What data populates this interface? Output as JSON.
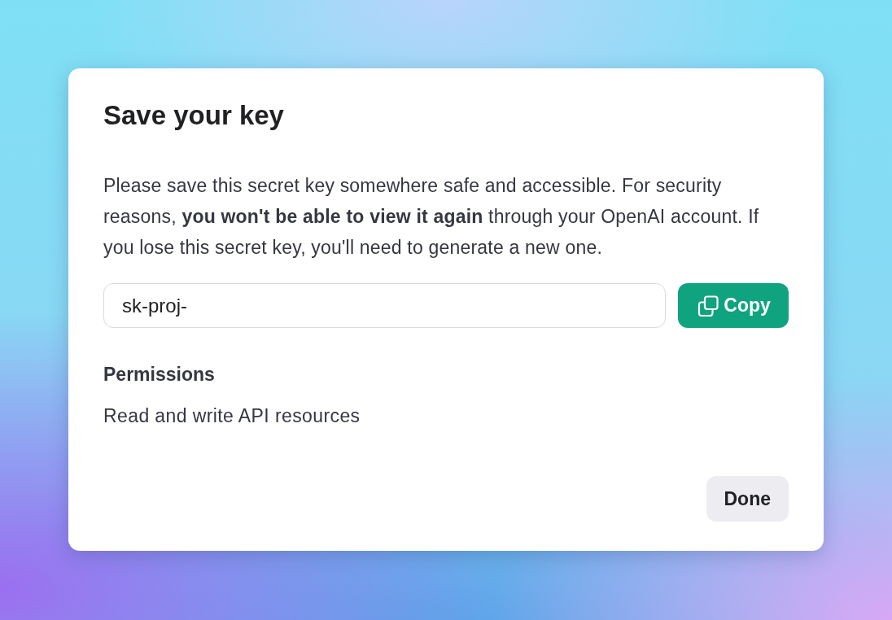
{
  "dialog": {
    "title": "Save your key",
    "message": "Please save this secret key somewhere safe and accessible. For security reasons, **you won't be able to view it again** through your OpenAI account. If you lose this secret key, you'll need to generate a new one.",
    "key_field": {
      "value": "sk-proj-"
    },
    "copy_button": {
      "label": "Copy"
    },
    "permissions": {
      "heading": "Permissions",
      "value": "Read and write API resources"
    },
    "buttons": [
      {
        "label": "Done"
      }
    ]
  }
}
